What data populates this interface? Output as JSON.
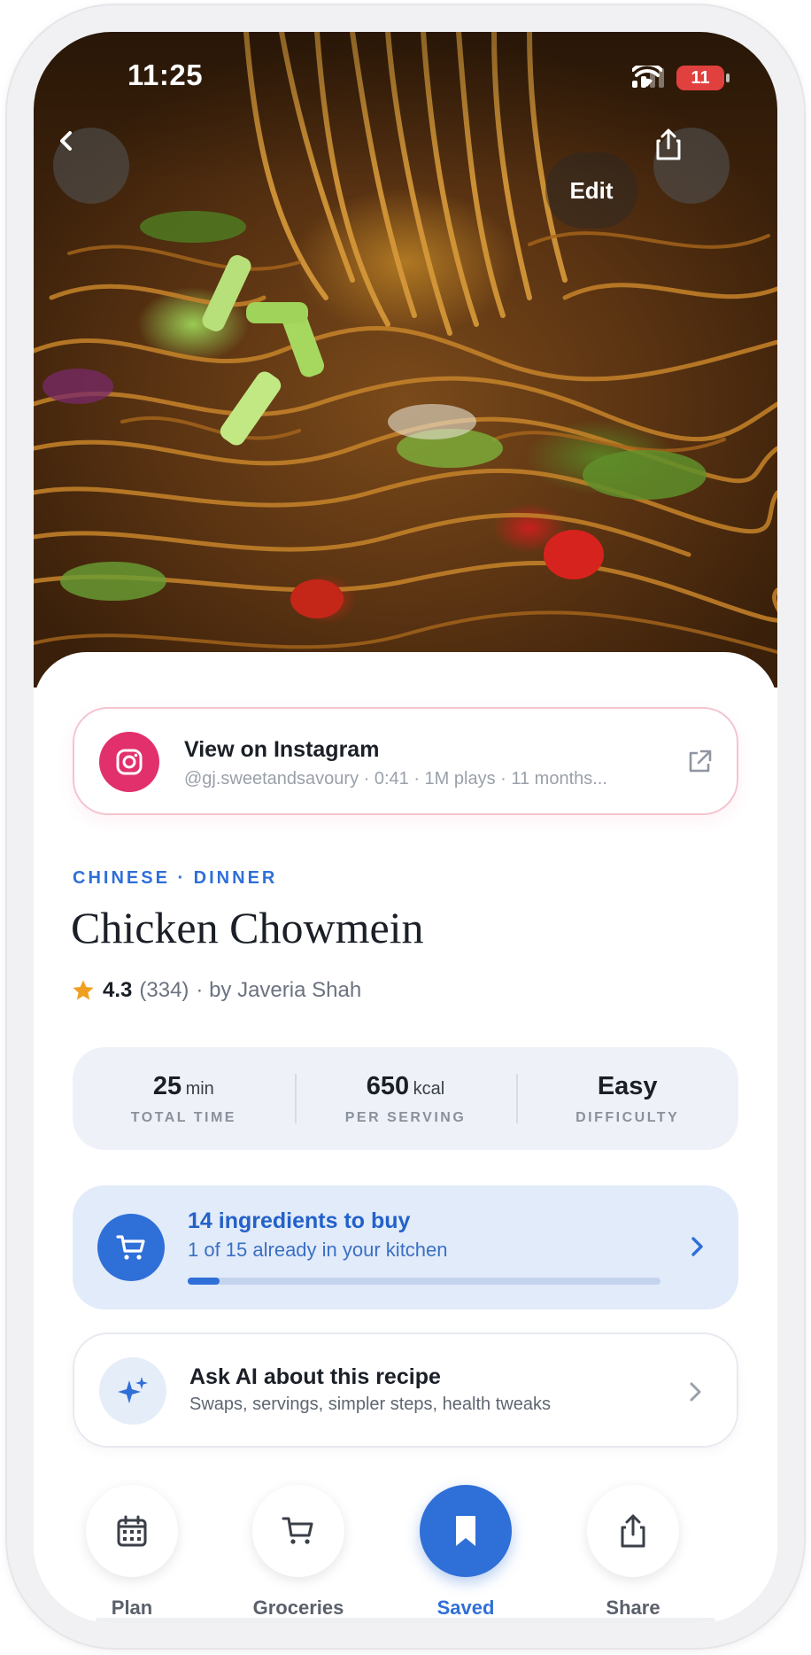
{
  "status_bar": {
    "time": "11:25",
    "battery": "11"
  },
  "header": {
    "edit_label": "Edit"
  },
  "instagram": {
    "title": "View on Instagram",
    "meta": "@gj.sweetandsavoury · 0:41 · 1M plays · 11 months..."
  },
  "recipe": {
    "category": "CHINESE · DINNER",
    "title": "Chicken Chowmein",
    "rating": "4.3",
    "rating_count": "(334)",
    "author": "· by Javeria Shah"
  },
  "stats": [
    {
      "value": "25",
      "unit": "min",
      "label": "TOTAL TIME"
    },
    {
      "value": "650",
      "unit": "kcal",
      "label": "PER SERVING"
    },
    {
      "value": "Easy",
      "unit": "",
      "label": "DIFFICULTY"
    }
  ],
  "ingredients": {
    "title": "14 ingredients to buy",
    "subtitle": "1 of 15 already in your kitchen",
    "have": 1,
    "total": 15
  },
  "ai": {
    "title": "Ask AI about this recipe",
    "subtitle": "Swaps, servings, simpler steps, health tweaks"
  },
  "dock": [
    {
      "label": "Plan",
      "icon": "calendar-icon",
      "active": false
    },
    {
      "label": "Groceries",
      "icon": "cart-icon",
      "active": false
    },
    {
      "label": "Saved",
      "icon": "bookmark-icon",
      "active": true
    },
    {
      "label": "Share",
      "icon": "share-icon",
      "active": false
    }
  ],
  "colors": {
    "accent": "#2f6fd8",
    "instagram": "#e1306c",
    "star": "#f0a020",
    "battery": "#e0403e"
  }
}
